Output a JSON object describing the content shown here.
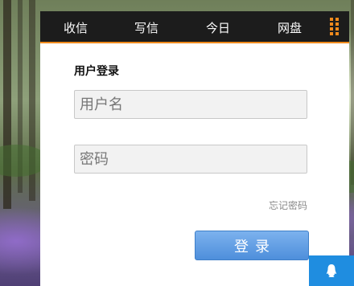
{
  "nav": {
    "items": [
      {
        "label": "收信"
      },
      {
        "label": "写信"
      },
      {
        "label": "今日"
      },
      {
        "label": "网盘"
      }
    ],
    "menu_icon": "grid-dots-icon",
    "accent_color": "#f08a1c"
  },
  "login": {
    "title": "用户登录",
    "username_placeholder": "用户名",
    "password_placeholder": "密码",
    "forgot_label": "忘记密码",
    "submit_label": "登录"
  },
  "chat": {
    "icon": "qq-penguin-icon",
    "color": "#1f8de0"
  }
}
